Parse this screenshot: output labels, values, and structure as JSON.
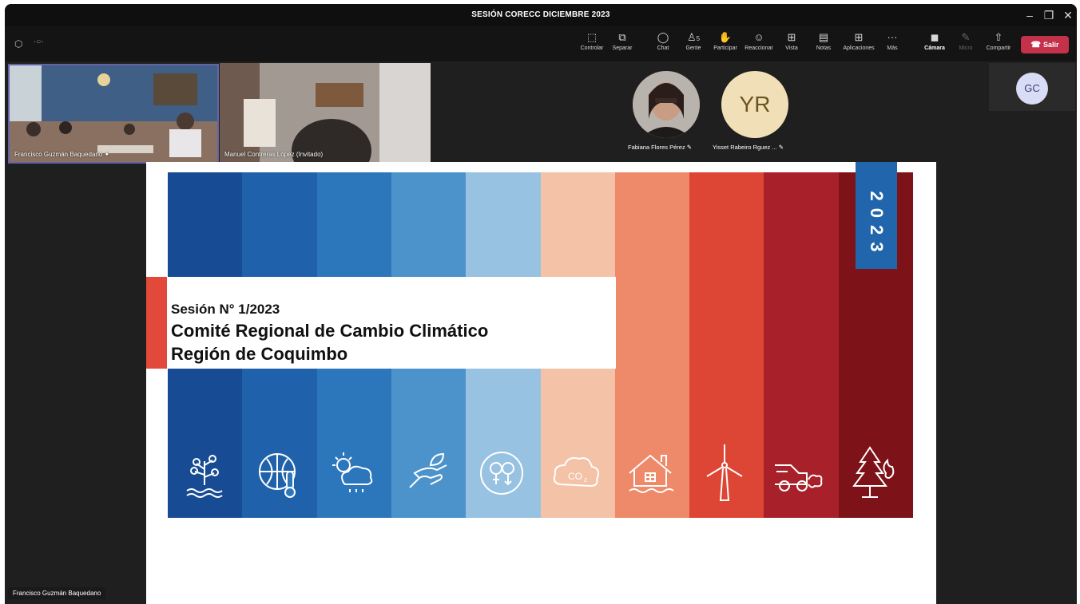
{
  "window": {
    "title": "SESIÓN CORECC DICIEMBRE 2023"
  },
  "toolbar": {
    "buttons": [
      {
        "label": "Controlar",
        "icon": "control-icon"
      },
      {
        "label": "Separar",
        "icon": "popout-icon"
      },
      {
        "label": "Chat",
        "icon": "chat-icon"
      },
      {
        "label": "Gente",
        "icon": "people-icon",
        "count": "5"
      },
      {
        "label": "Participar",
        "icon": "raise-hand-icon"
      },
      {
        "label": "Reaccionar",
        "icon": "smile-icon"
      },
      {
        "label": "Vista",
        "icon": "view-icon"
      },
      {
        "label": "Notas",
        "icon": "notes-icon"
      },
      {
        "label": "Aplicaciones",
        "icon": "apps-icon"
      },
      {
        "label": "Más",
        "icon": "more-icon"
      },
      {
        "label": "Cámara",
        "icon": "camera-off-icon"
      },
      {
        "label": "Micro",
        "icon": "mic-off-icon"
      },
      {
        "label": "Compartir",
        "icon": "share-icon"
      }
    ],
    "leave_label": "Salir"
  },
  "participants": {
    "tile1_name": "Francisco Guzmán Baquedano",
    "tile2_name": "Manuel Contreras López (Invitado)",
    "p1_name": "Fabiana Flores Pérez",
    "p2_initials": "YR",
    "p2_name": "Yisset Rabeiro Rguez ...",
    "p3_initials": "GC"
  },
  "slide": {
    "line1": "Sesión N° 1/2023",
    "line2": "Comité Regional de Cambio Climático",
    "line3": "Región de Coquimbo",
    "year": "2023",
    "stripe_colors": [
      "#174c94",
      "#1f62ab",
      "#2c77bb",
      "#4d93cb",
      "#98c2e1",
      "#f4c2a7",
      "#ee8a69",
      "#dd4534",
      "#a8202a",
      "#7d1218"
    ],
    "year_box_color": "#2166ac",
    "accent_color": "#e2493b"
  },
  "presenter": {
    "name": "Francisco Guzmán Baquedano"
  }
}
